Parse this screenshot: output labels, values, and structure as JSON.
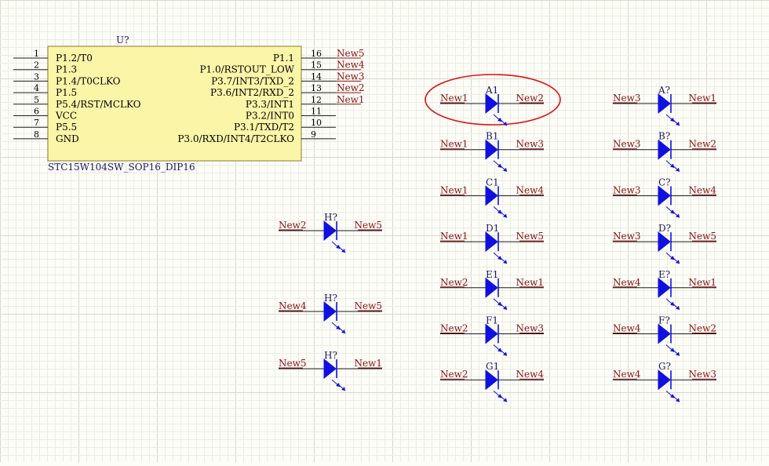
{
  "colors": {
    "background": "#fdfdf8",
    "grid_minor": "#ecece4",
    "grid_major": "#d8d8cf",
    "chip_fill": "#fbf5a8",
    "chip_border": "#8a7a2a",
    "wire": "#1a1a1a",
    "pin_text": "#000000",
    "net_label": "#8b1010",
    "designator": "#1a1a60",
    "led_blue": "#1010e0",
    "highlight": "#e01010"
  },
  "ic": {
    "designator": "U?",
    "part_name": "STC15W104SW_SOP16_DIP16",
    "left_pins": [
      {
        "num": "1",
        "name": "P1.2/T0"
      },
      {
        "num": "2",
        "name": "P1.3"
      },
      {
        "num": "3",
        "name": "P1.4/T0CLKO"
      },
      {
        "num": "4",
        "name": "P1.5"
      },
      {
        "num": "5",
        "name": "P5.4/RST/MCLKO"
      },
      {
        "num": "6",
        "name": "VCC"
      },
      {
        "num": "7",
        "name": "P5.5"
      },
      {
        "num": "8",
        "name": "GND"
      }
    ],
    "right_pins": [
      {
        "num": "16",
        "name": "P1.1",
        "net": "New5"
      },
      {
        "num": "15",
        "name": "P1.0/RSTOUT_LOW",
        "net": "New4"
      },
      {
        "num": "14",
        "name": "P3.7/INT3/TXD_2",
        "net": "New3"
      },
      {
        "num": "13",
        "name": "P3.6/INT2/RXD_2",
        "net": "New2"
      },
      {
        "num": "12",
        "name": "P3.3/INT1",
        "net": "New1"
      },
      {
        "num": "11",
        "name": "P3.2/INT0",
        "net": ""
      },
      {
        "num": "10",
        "name": "P3.1/TXD/T2",
        "net": ""
      },
      {
        "num": "9",
        "name": "P3.0/RXD/INT4/T2CLKO",
        "net": ""
      }
    ]
  },
  "leds_col1": [
    {
      "designator": "A1",
      "left_net": "New1",
      "right_net": "New2"
    },
    {
      "designator": "B1",
      "left_net": "New1",
      "right_net": "New3"
    },
    {
      "designator": "C1",
      "left_net": "New1",
      "right_net": "New4"
    },
    {
      "designator": "D1",
      "left_net": "New1",
      "right_net": "New5"
    },
    {
      "designator": "E1",
      "left_net": "New2",
      "right_net": "New1"
    },
    {
      "designator": "F1",
      "left_net": "New2",
      "right_net": "New3"
    },
    {
      "designator": "G1",
      "left_net": "New2",
      "right_net": "New4"
    }
  ],
  "leds_col2": [
    {
      "designator": "A?",
      "left_net": "New3",
      "right_net": "New1"
    },
    {
      "designator": "B?",
      "left_net": "New3",
      "right_net": "New2"
    },
    {
      "designator": "C?",
      "left_net": "New3",
      "right_net": "New4"
    },
    {
      "designator": "D?",
      "left_net": "New3",
      "right_net": "New5"
    },
    {
      "designator": "E?",
      "left_net": "New4",
      "right_net": "New1"
    },
    {
      "designator": "F?",
      "left_net": "New4",
      "right_net": "New2"
    },
    {
      "designator": "G?",
      "left_net": "New4",
      "right_net": "New3"
    }
  ],
  "leds_h": [
    {
      "designator": "H?",
      "left_net": "New2",
      "right_net": "New5"
    },
    {
      "designator": "H?",
      "left_net": "New4",
      "right_net": "New5"
    },
    {
      "designator": "H?",
      "left_net": "New5",
      "right_net": "New1"
    }
  ]
}
